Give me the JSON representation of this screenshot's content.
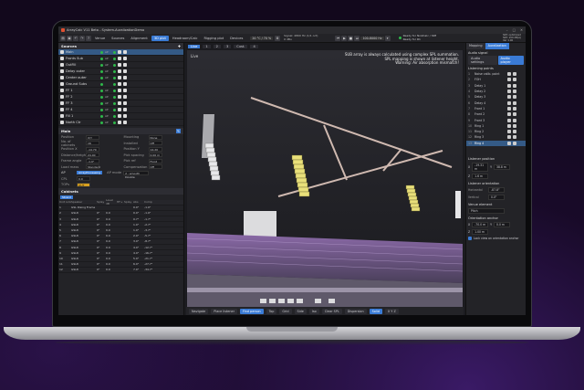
{
  "window": {
    "title": "ArrayCalc V11 Beta - System-AuralizationDemo",
    "controls": [
      "–",
      "□",
      "✕"
    ]
  },
  "menu": {
    "items": [
      {
        "label": "Venue"
      },
      {
        "label": "Sources"
      },
      {
        "label": "Alignment"
      },
      {
        "label": "3D plot",
        "active": true
      },
      {
        "label": "Headroom/Calc"
      },
      {
        "label": "Rigging plot"
      },
      {
        "label": "Devices"
      }
    ],
    "temp": "20 °C / 70 %",
    "signal": [
      "Signal: 4800 Hz (1/1 oct)",
      "0 dBu"
    ],
    "zoom": "100-8000 Hz",
    "ready": [
      "Ready for NoizCalc / SIM",
      "Ready for R1"
    ],
    "right_info": [
      "SIM: optimized",
      "SIM: 100 dB(A)",
      "Ver 1.00"
    ]
  },
  "sources": {
    "header": "Sources",
    "items": [
      {
        "name": "Main",
        "tag": "AP",
        "sel": true
      },
      {
        "name": "Fronts Sub",
        "tag": "AP"
      },
      {
        "name": "OutFill",
        "tag": "AP"
      },
      {
        "name": "Delay outer",
        "tag": "AP"
      },
      {
        "name": "Center outer",
        "tag": "AP"
      },
      {
        "name": "Ground Subs",
        "tag": ""
      },
      {
        "name": "FF 1",
        "tag": "AP"
      },
      {
        "name": "FF 2",
        "tag": "AP"
      },
      {
        "name": "FF 3",
        "tag": "AP"
      },
      {
        "name": "FF 4",
        "tag": "AP"
      },
      {
        "name": "Fill 1",
        "tag": "AP"
      },
      {
        "name": "North Ctr",
        "tag": "AP"
      }
    ]
  },
  "main": {
    "header": "Main",
    "fields_left": [
      {
        "label": "Position",
        "value": "X/Y"
      },
      {
        "label": "No. of cabinets",
        "value": "16"
      },
      {
        "label": "Position X",
        "value": "-14.70 m"
      },
      {
        "label": "Distance/height",
        "value": "24.00 m"
      },
      {
        "label": "Frame angle",
        "value": "-1.0°"
      },
      {
        "label": "Load mass",
        "value": "Standard"
      }
    ],
    "fields_right": [
      {
        "label": "Mounting",
        "value": "None"
      },
      {
        "label": "Installed",
        "value": "Off"
      },
      {
        "label": "Position Y",
        "value": "14.20 m"
      },
      {
        "label": "Pick spacing",
        "value": "0.00 m"
      },
      {
        "label": "Pick ref",
        "value": "Front"
      },
      {
        "label": "Compensation",
        "value": "Off"
      }
    ],
    "array_processing": "ArrayProcessing",
    "ap_mode": "AP mode",
    "ap_value": "2 : smooth Double",
    "cpl_label": "CPL",
    "cpl_value": "0.0",
    "tops_label": "TOPs",
    "tops_value": "OUT"
  },
  "cabinets": {
    "header": "Cabinets",
    "subheader": "Strand",
    "columns": [
      "Unit",
      "Link",
      "Speaker",
      "Splay",
      "Level dB",
      "HF+",
      "Splay",
      "Abs",
      "Comp"
    ],
    "rows": [
      {
        "n": "1",
        "spk": "GSL Rising Frame",
        "splay": "",
        "lvl": "",
        "abs": "0.0°",
        "ab2": "-1.0°"
      },
      {
        "n": "2",
        "spk": "GSL8",
        "splay": "0°",
        "lvl": "0.0",
        "abs": "0.0°",
        "ab2": "-1.0°"
      },
      {
        "n": "3",
        "spk": "GSL8",
        "splay": "0°",
        "lvl": "0.0",
        "abs": "0.7°",
        "ab2": "-1.7°"
      },
      {
        "n": "4",
        "spk": "GSL8",
        "splay": "0°",
        "lvl": "0.0",
        "abs": "1.0°",
        "ab2": "-2.7°"
      },
      {
        "n": "5",
        "spk": "GSL8",
        "splay": "0°",
        "lvl": "0.0",
        "abs": "1.0°",
        "ab2": "-3.7°"
      },
      {
        "n": "6",
        "spk": "GSL8",
        "splay": "0°",
        "lvl": "0.0",
        "abs": "2.0°",
        "ab2": "-5.7°"
      },
      {
        "n": "7",
        "spk": "GSL8",
        "splay": "0°",
        "lvl": "0.0",
        "abs": "3.0°",
        "ab2": "-8.7°"
      },
      {
        "n": "8",
        "spk": "GSL8",
        "splay": "0°",
        "lvl": "0.0",
        "abs": "4.0°",
        "ab2": "-12.7°"
      },
      {
        "n": "9",
        "spk": "GSL8",
        "splay": "0°",
        "lvl": "0.0",
        "abs": "4.0°",
        "ab2": "-16.7°"
      },
      {
        "n": "10",
        "spk": "GSL8",
        "splay": "0°",
        "lvl": "0.0",
        "abs": "5.0°",
        "ab2": "-21.7°"
      },
      {
        "n": "11",
        "spk": "GSL8",
        "splay": "0°",
        "lvl": "0.0",
        "abs": "6.0°",
        "ab2": "-27.7°"
      },
      {
        "n": "12",
        "spk": "GSL8",
        "splay": "0°",
        "lvl": "0.0",
        "abs": "7.0°",
        "ab2": "-34.7°"
      }
    ]
  },
  "viewport": {
    "tabs": [
      "Live",
      "1",
      "2",
      "3",
      "Cust.",
      "4"
    ],
    "live_label": "Live",
    "notice": [
      "SUB array is always calculated using complex SPL summation.",
      "SPL mapping is shown at listener height.",
      "Warning: Air absorption mismatch!"
    ],
    "bottom": [
      {
        "label": "Navigate"
      },
      {
        "label": "Place listener"
      },
      {
        "label": "Find person",
        "on": true
      },
      {
        "label": "Top"
      },
      {
        "label": "Grid"
      },
      {
        "label": "Side"
      },
      {
        "label": "Iso"
      },
      {
        "label": "Clear SPL"
      },
      {
        "label": "Dispersion"
      },
      {
        "label": "Solid",
        "on": true
      },
      {
        "label": "X Y Z"
      }
    ]
  },
  "right": {
    "tabs": [
      {
        "label": "Mapping"
      },
      {
        "label": "Auralization",
        "active": true
      }
    ],
    "audio_signal": "Audio signal",
    "audio_buttons": [
      "Audio settings",
      "Audio player"
    ],
    "listening_header": "Listening points",
    "points": [
      {
        "n": "1",
        "name": "Noise calib. point"
      },
      {
        "n": "2",
        "name": "FOH"
      },
      {
        "n": "3",
        "name": "Delay 1"
      },
      {
        "n": "4",
        "name": "Delay 2"
      },
      {
        "n": "5",
        "name": "Delay 3"
      },
      {
        "n": "6",
        "name": "Delay 4"
      },
      {
        "n": "7",
        "name": "Front 1"
      },
      {
        "n": "8",
        "name": "Front 2"
      },
      {
        "n": "9",
        "name": "Front 3"
      },
      {
        "n": "10",
        "name": "Ring 1"
      },
      {
        "n": "11",
        "name": "Ring 2"
      },
      {
        "n": "12",
        "name": "Ring 3"
      },
      {
        "n": "13",
        "name": "Ring 4",
        "sel": true
      }
    ],
    "listener_pos": "Listener position",
    "pos_x": "-19.31 m",
    "pos_y": "38.8 m",
    "pos_z": "1.6 m",
    "orientation": "Listener orientation",
    "horizontal": "Horizontal",
    "horizontal_val": "-87.8°",
    "vertical": "Vertical",
    "vertical_val": "0.0°",
    "venue_element": "Venue element",
    "venue_val": "Pitch",
    "anchor": "Orientation anchor",
    "anc_x": "-70.0 m",
    "anc_y": "0.0 m",
    "anc_z": "1.00 m",
    "lock": "Lock view on orientation anchor"
  }
}
